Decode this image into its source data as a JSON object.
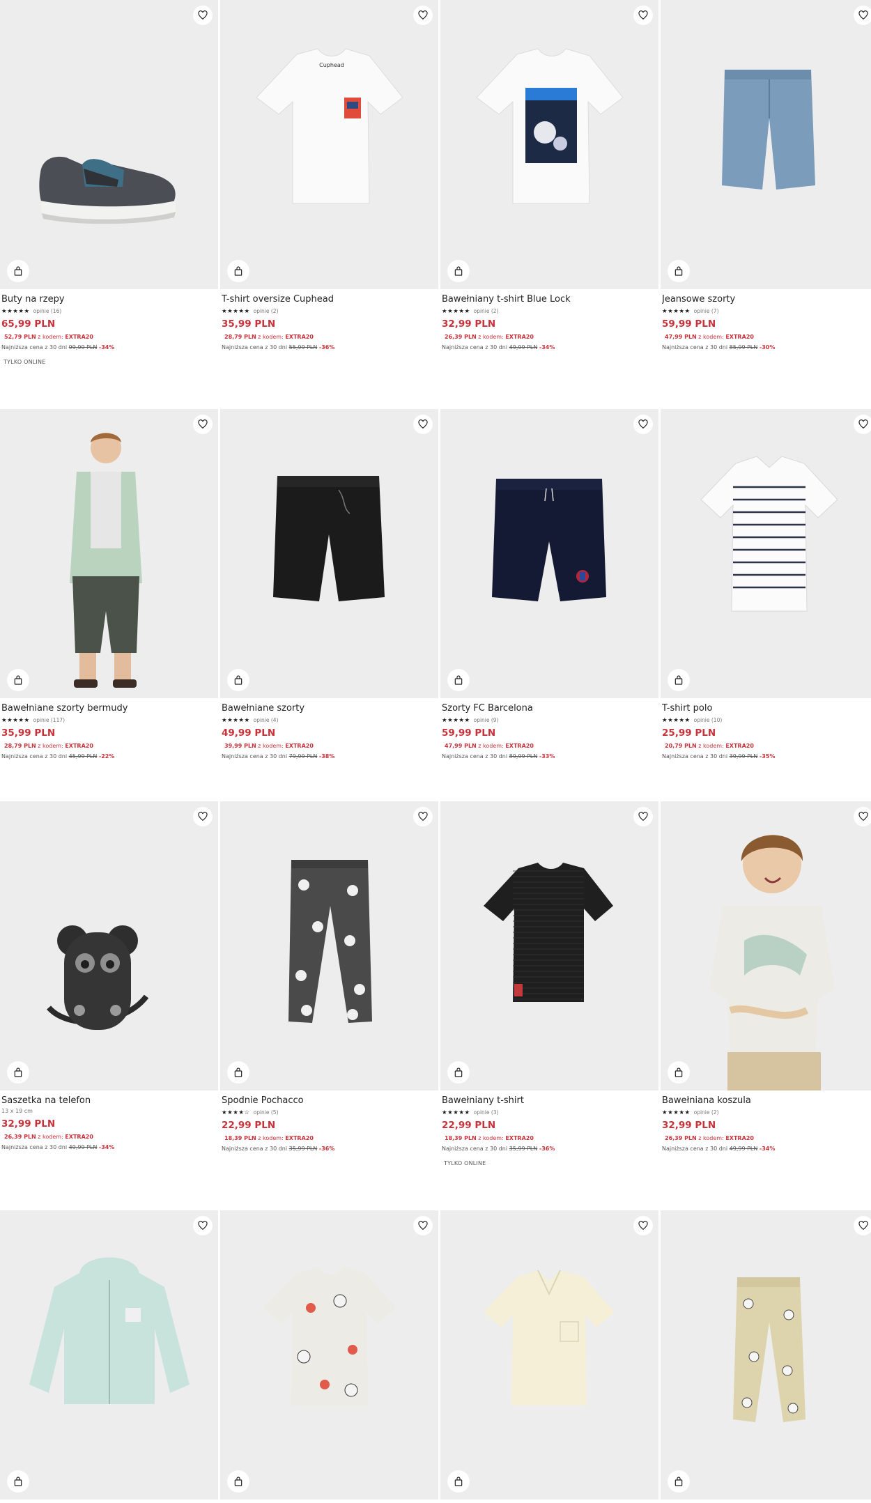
{
  "icons": {
    "favorite": "heart-outline-icon",
    "cart": "shopping-bag-icon"
  },
  "colors": {
    "price": "#c8323a",
    "image_bg": "#ededed"
  },
  "products": [
    {
      "title": "Buty na rzepy",
      "stars": "★★★★★",
      "opinions": "opinie (16)",
      "price": "65,99 PLN",
      "promo_price": "52,79 PLN",
      "promo_text": "z kodem:",
      "promo_code": "EXTRA20",
      "lowest_label": "Najniższa cena z 30 dni",
      "lowest_old": "99,99 PLN",
      "lowest_disc": "-34%",
      "badge": "TYLKO ONLINE"
    },
    {
      "title": "T-shirt oversize Cuphead",
      "stars": "★★★★★",
      "opinions": "opinie (2)",
      "price": "35,99 PLN",
      "promo_price": "28,79 PLN",
      "promo_text": "z kodem:",
      "promo_code": "EXTRA20",
      "lowest_label": "Najniższa cena z 30 dni",
      "lowest_old": "55,99 PLN",
      "lowest_disc": "-36%"
    },
    {
      "title": "Bawełniany t-shirt Blue Lock",
      "stars": "★★★★★",
      "opinions": "opinie (2)",
      "price": "32,99 PLN",
      "promo_price": "26,39 PLN",
      "promo_text": "z kodem:",
      "promo_code": "EXTRA20",
      "lowest_label": "Najniższa cena z 30 dni",
      "lowest_old": "49,99 PLN",
      "lowest_disc": "-34%"
    },
    {
      "title": "Jeansowe szorty",
      "stars": "★★★★★",
      "opinions": "opinie (7)",
      "price": "59,99 PLN",
      "promo_price": "47,99 PLN",
      "promo_text": "z kodem:",
      "promo_code": "EXTRA20",
      "lowest_label": "Najniższa cena z 30 dni",
      "lowest_old": "85,99 PLN",
      "lowest_disc": "-30%"
    },
    {
      "title": "Bawełniane szorty bermudy",
      "stars": "★★★★★",
      "opinions": "opinie (117)",
      "price": "35,99 PLN",
      "promo_price": "28,79 PLN",
      "promo_text": "z kodem:",
      "promo_code": "EXTRA20",
      "lowest_label": "Najniższa cena z 30 dni",
      "lowest_old": "45,99 PLN",
      "lowest_disc": "-22%"
    },
    {
      "title": "Bawełniane szorty",
      "stars": "★★★★★",
      "opinions": "opinie (4)",
      "price": "49,99 PLN",
      "promo_price": "39,99 PLN",
      "promo_text": "z kodem:",
      "promo_code": "EXTRA20",
      "lowest_label": "Najniższa cena z 30 dni",
      "lowest_old": "79,99 PLN",
      "lowest_disc": "-38%"
    },
    {
      "title": "Szorty FC Barcelona",
      "stars": "★★★★★",
      "opinions": "opinie (9)",
      "price": "59,99 PLN",
      "promo_price": "47,99 PLN",
      "promo_text": "z kodem:",
      "promo_code": "EXTRA20",
      "lowest_label": "Najniższa cena z 30 dni",
      "lowest_old": "89,99 PLN",
      "lowest_disc": "-33%"
    },
    {
      "title": "T-shirt polo",
      "stars": "★★★★★",
      "opinions": "opinie (10)",
      "price": "25,99 PLN",
      "promo_price": "20,79 PLN",
      "promo_text": "z kodem:",
      "promo_code": "EXTRA20",
      "lowest_label": "Najniższa cena z 30 dni",
      "lowest_old": "39,99 PLN",
      "lowest_disc": "-35%"
    },
    {
      "title": "Saszetka na telefon",
      "dims": "13 x 19 cm",
      "price": "32,99 PLN",
      "promo_price": "26,39 PLN",
      "promo_text": "z kodem:",
      "promo_code": "EXTRA20",
      "lowest_label": "Najniższa cena z 30 dni",
      "lowest_old": "49,99 PLN",
      "lowest_disc": "-34%"
    },
    {
      "title": "Spodnie Pochacco",
      "stars": "★★★★☆",
      "opinions": "opinie (5)",
      "price": "22,99 PLN",
      "promo_price": "18,39 PLN",
      "promo_text": "z kodem:",
      "promo_code": "EXTRA20",
      "lowest_label": "Najniższa cena z 30 dni",
      "lowest_old": "35,99 PLN",
      "lowest_disc": "-36%"
    },
    {
      "title": "Bawełniany t-shirt",
      "stars": "★★★★★",
      "opinions": "opinie (3)",
      "price": "22,99 PLN",
      "promo_price": "18,39 PLN",
      "promo_text": "z kodem:",
      "promo_code": "EXTRA20",
      "lowest_label": "Najniższa cena z 30 dni",
      "lowest_old": "35,99 PLN",
      "lowest_disc": "-36%",
      "badge": "TYLKO ONLINE"
    },
    {
      "title": "Bawełniana koszula",
      "stars": "★★★★★",
      "opinions": "opinie (2)",
      "price": "32,99 PLN",
      "promo_price": "26,39 PLN",
      "promo_text": "z kodem:",
      "promo_code": "EXTRA20",
      "lowest_label": "Najniższa cena z 30 dni",
      "lowest_old": "49,99 PLN",
      "lowest_disc": "-34%"
    },
    {
      "title": ""
    },
    {
      "title": ""
    },
    {
      "title": ""
    },
    {
      "title": ""
    }
  ]
}
